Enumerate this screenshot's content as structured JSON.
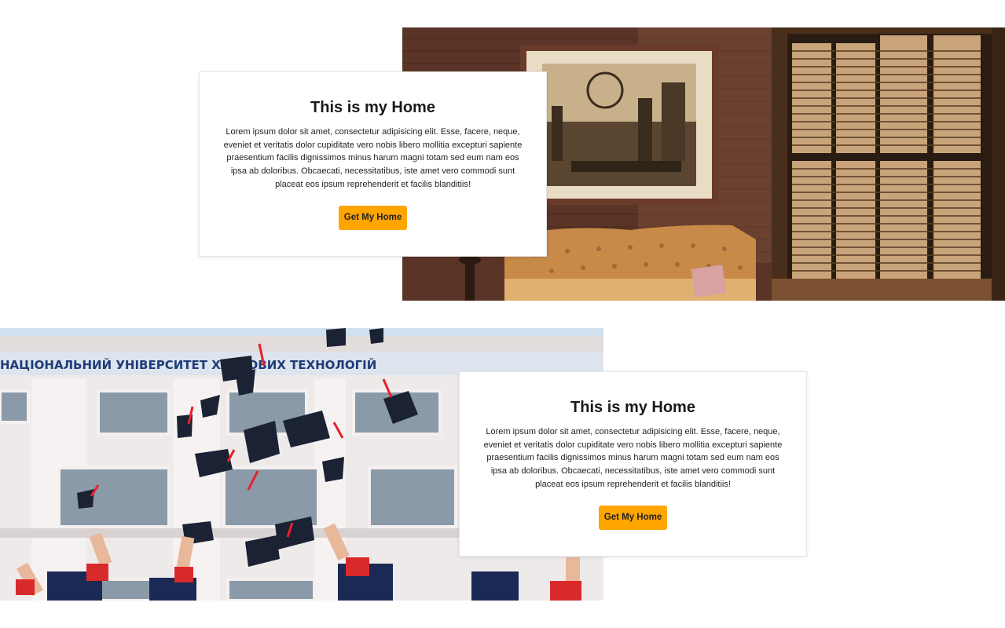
{
  "sections": [
    {
      "title": "This is my Home",
      "body": "Lorem ipsum dolor sit amet, consectetur adipisicing elit. Esse, facere, neque, eveniet et veritatis dolor cupiditate vero nobis libero mollitia excepturi sapiente praesentium facilis dignissimos minus harum magni totam sed eum nam eos ipsa ab doloribus. Obcaecati, necessitatibus, iste amet vero commodi sunt placeat eos ipsum reprehenderit et facilis blanditiis!",
      "button_label": "Get My Home",
      "image": "living-room-interior-photo"
    },
    {
      "title": "This is my Home",
      "body": "Lorem ipsum dolor sit amet, consectetur adipisicing elit. Esse, facere, neque, eveniet et veritatis dolor cupiditate vero nobis libero mollitia excepturi sapiente praesentium facilis dignissimos minus harum magni totam sed eum nam eos ipsa ab doloribus. Obcaecati, necessitatibus, iste amet vero commodi sunt placeat eos ipsum reprehenderit et facilis blanditiis!",
      "button_label": "Get My Home",
      "image": "graduation-caps-photo",
      "image_text": "НАЦІОНАЛЬНИЙ УНІВЕРСИТЕТ ХАРЧОВИХ ТЕХНОЛОГІЙ"
    }
  ],
  "colors": {
    "accent": "#ffa500",
    "page_background": "#ffffff",
    "card_background": "#ffffff"
  }
}
